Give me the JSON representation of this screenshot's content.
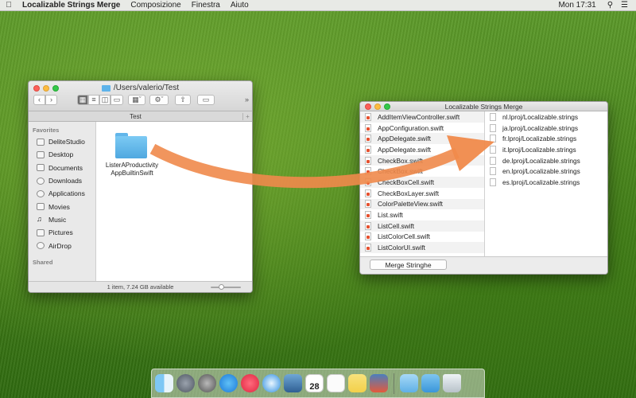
{
  "menubar": {
    "app_name": "Localizable Strings Merge",
    "items": [
      "Composizione",
      "Finestra",
      "Aiuto"
    ],
    "clock": "Mon 17:31"
  },
  "finder": {
    "title": "/Users/valerio/Test",
    "tab": "Test",
    "sidebar_heading_favorites": "Favorites",
    "sidebar_items": [
      {
        "label": "DeliteStudio",
        "icon": "folder-icon"
      },
      {
        "label": "Desktop",
        "icon": "desktop-icon"
      },
      {
        "label": "Documents",
        "icon": "documents-icon"
      },
      {
        "label": "Downloads",
        "icon": "downloads-icon"
      },
      {
        "label": "Applications",
        "icon": "applications-icon"
      },
      {
        "label": "Movies",
        "icon": "movies-icon"
      },
      {
        "label": "Music",
        "icon": "music-icon"
      },
      {
        "label": "Pictures",
        "icon": "pictures-icon"
      },
      {
        "label": "AirDrop",
        "icon": "airdrop-icon"
      }
    ],
    "sidebar_heading_shared": "Shared",
    "folder_name_line1": "ListerAProductivity",
    "folder_name_line2": "AppBuiltinSwift",
    "status": "1 item, 7.24 GB available"
  },
  "lsm": {
    "title": "Localizable Strings Merge",
    "left_files": [
      "AddItemViewController.swift",
      "AppConfiguration.swift",
      "AppDelegate.swift",
      "AppDelegate.swift",
      "CheckBox.swift",
      "CheckBox.swift",
      "CheckBoxCell.swift",
      "CheckBoxLayer.swift",
      "ColorPaletteView.swift",
      "List.swift",
      "ListCell.swift",
      "ListColorCell.swift",
      "ListColorUI.swift"
    ],
    "right_files": [
      "nl.lproj/Localizable.strings",
      "ja.lproj/Localizable.strings",
      "fr.lproj/Localizable.strings",
      "it.lproj/Localizable.strings",
      "de.lproj/Localizable.strings",
      "en.lproj/Localizable.strings",
      "es.lproj/Localizable.strings"
    ],
    "merge_button": "Merge Stringhe"
  },
  "colors": {
    "arrow": "#f08a4b",
    "finder_folder": "#5eb3ea"
  },
  "dock": {
    "icons": [
      "finder-icon",
      "launchpad-icon",
      "system-preferences-icon",
      "app-store-icon",
      "itunes-icon",
      "safari-icon",
      "preview-icon",
      "calendar-icon",
      "reminders-icon",
      "notes-icon",
      "xcode-icon",
      "folder-icon",
      "downloads-icon",
      "trash-icon"
    ],
    "calendar_day": "28"
  }
}
